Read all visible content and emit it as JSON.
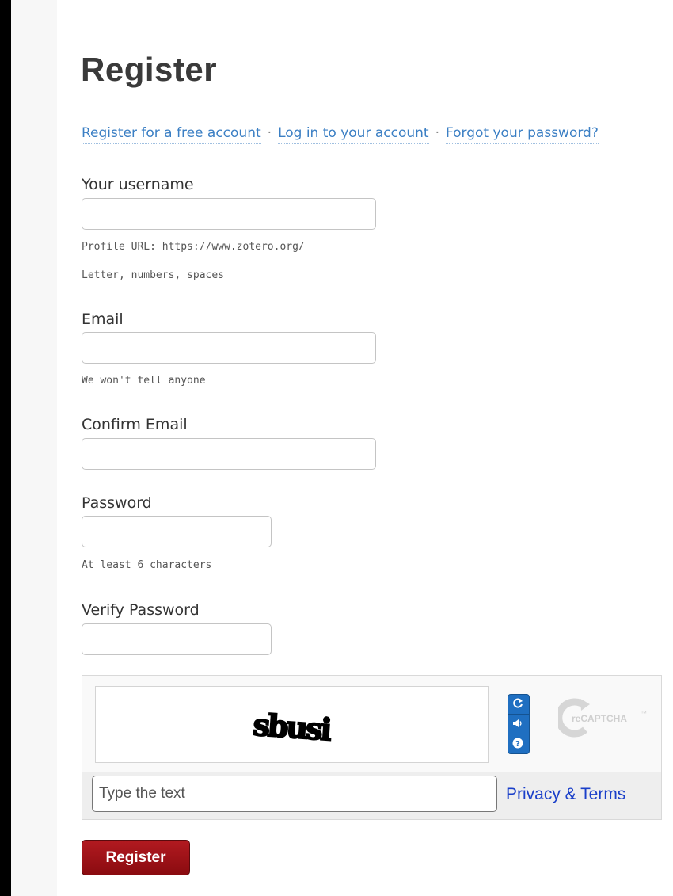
{
  "page": {
    "title": "Register"
  },
  "nav": {
    "items": [
      {
        "label": "Register for a free account"
      },
      {
        "label": "Log in to your account"
      },
      {
        "label": "Forgot your password?"
      }
    ],
    "separator": "·"
  },
  "form": {
    "username": {
      "label": "Your username",
      "value": "",
      "hint_url": "Profile URL: https://www.zotero.org/",
      "hint_chars": "Letter, numbers, spaces"
    },
    "email": {
      "label": "Email",
      "value": "",
      "hint": "We won't tell anyone"
    },
    "confirm_email": {
      "label": "Confirm Email",
      "value": ""
    },
    "password": {
      "label": "Password",
      "value": "",
      "hint": "At least 6 characters"
    },
    "verify_password": {
      "label": "Verify Password",
      "value": ""
    }
  },
  "captcha": {
    "challenge_text": "sbusi",
    "input_placeholder": "Type the text",
    "input_value": "",
    "privacy_label": "Privacy & Terms",
    "logo_text": "reCAPTCHA",
    "logo_tm": "™",
    "buttons": {
      "refresh": "refresh-icon",
      "audio": "audio-icon",
      "help": "help-icon"
    },
    "button_color": "#1f6fc1"
  },
  "submit": {
    "label": "Register",
    "color": "#9b1015"
  },
  "colors": {
    "link": "#3b7fc4",
    "privacy_link": "#1a3fc9",
    "heading": "#3a3a3a"
  }
}
